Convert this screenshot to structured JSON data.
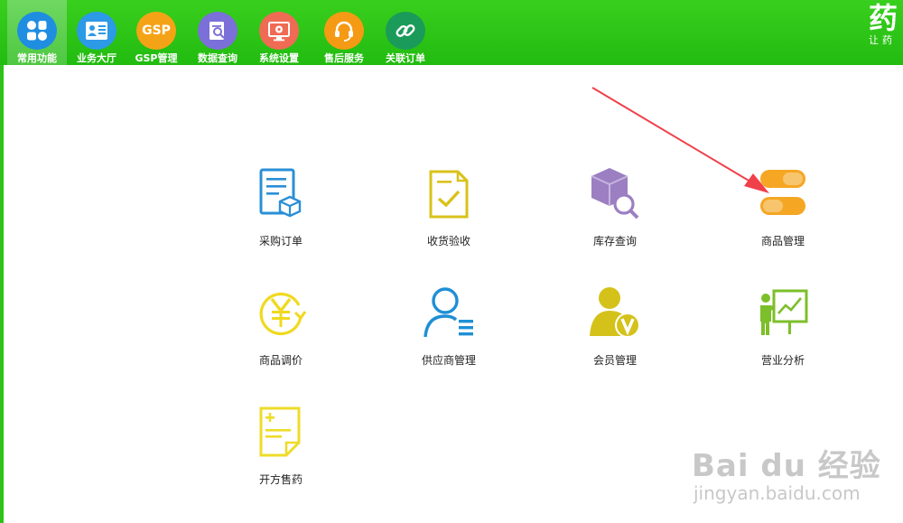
{
  "nav": {
    "tabs": [
      {
        "label": "常用功能",
        "color": "#1f8de0"
      },
      {
        "label": "业务大厅",
        "color": "#2c9ae6"
      },
      {
        "label": "GSP管理",
        "color": "#f5a316"
      },
      {
        "label": "数据查询",
        "color": "#7b6fd9"
      },
      {
        "label": "系统设置",
        "color": "#f06b54"
      },
      {
        "label": "售后服务",
        "color": "#f59a14"
      },
      {
        "label": "关联订单",
        "color": "#1a9b5a"
      }
    ],
    "gsp_text": "GSP"
  },
  "brand": {
    "big": "药",
    "small": "让药"
  },
  "features": [
    {
      "label": "采购订单",
      "color": "#2a8fd6"
    },
    {
      "label": "收货验收",
      "color": "#d9c21a"
    },
    {
      "label": "库存查询",
      "color": "#9b7fc2"
    },
    {
      "label": "商品管理",
      "color": "#f5a623"
    },
    {
      "label": "商品调价",
      "color": "#f0d91e"
    },
    {
      "label": "供应商管理",
      "color": "#1f8fd6"
    },
    {
      "label": "会员管理",
      "color": "#d4c21a"
    },
    {
      "label": "营业分析",
      "color": "#7cbf2a"
    },
    {
      "label": "开方售药",
      "color": "#eedc2a"
    }
  ],
  "watermark": {
    "main": "Bai du 经验",
    "sub": "jingyan.baidu.com"
  },
  "annotation": {
    "arrow_color": "#f0404a"
  }
}
